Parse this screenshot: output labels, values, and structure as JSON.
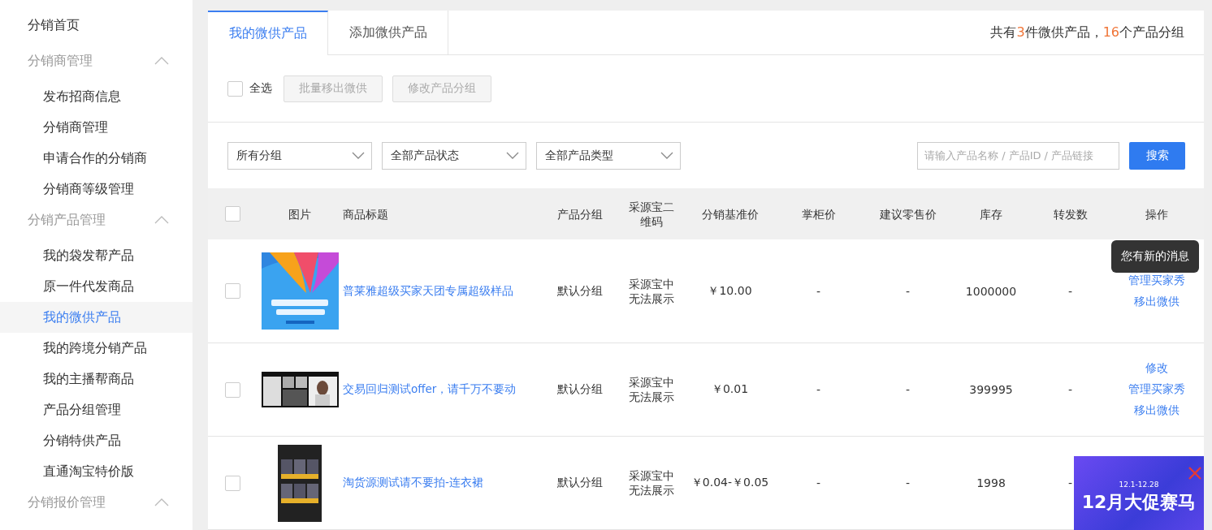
{
  "sidebar": {
    "items": [
      {
        "label": "分销首页",
        "kind": "link",
        "selected": false
      },
      {
        "label": "分销商管理",
        "kind": "group",
        "expanded": true,
        "children": [
          {
            "label": "发布招商信息",
            "selected": false
          },
          {
            "label": "分销商管理",
            "selected": false
          },
          {
            "label": "申请合作的分销商",
            "selected": false
          },
          {
            "label": "分销商等级管理",
            "selected": false
          }
        ]
      },
      {
        "label": "分销产品管理",
        "kind": "group",
        "expanded": true,
        "children": [
          {
            "label": "我的袋发帮产品",
            "selected": false
          },
          {
            "label": "原一件代发商品",
            "selected": false
          },
          {
            "label": "我的微供产品",
            "selected": true
          },
          {
            "label": "我的跨境分销产品",
            "selected": false
          },
          {
            "label": "我的主播帮商品",
            "selected": false
          },
          {
            "label": "产品分组管理",
            "selected": false
          },
          {
            "label": "分销特供产品",
            "selected": false
          },
          {
            "label": "直通淘宝特价版",
            "selected": false
          }
        ]
      },
      {
        "label": "分销报价管理",
        "kind": "group",
        "expanded": true
      }
    ]
  },
  "tabs": [
    {
      "label": "我的微供产品",
      "selected": true
    },
    {
      "label": "添加微供产品",
      "selected": false
    }
  ],
  "summary": [
    {
      "text": "共有",
      "highlight": false
    },
    {
      "text": "3",
      "highlight": true
    },
    {
      "text": "件微供产品，",
      "highlight": false
    },
    {
      "text": "16",
      "highlight": true
    },
    {
      "text": "个产品分组",
      "highlight": false
    }
  ],
  "toolbar": {
    "select_all": {
      "label": "全选",
      "checked": false
    },
    "buttons": [
      {
        "label": "批量移出微供",
        "disabled": true
      },
      {
        "label": "修改产品分组",
        "disabled": true
      }
    ]
  },
  "filters": {
    "selects": [
      "所有分组",
      "全部产品状态",
      "全部产品类型"
    ],
    "search": {
      "placeholder": "请输入产品名称 / 产品ID / 产品链接"
    },
    "search_button": "搜索"
  },
  "table": {
    "header_checked": false,
    "columns": [
      "图片",
      "商品标题",
      "产品分组",
      "采源宝二维码",
      "分销基准价",
      "掌柜价",
      "建议零售价",
      "库存",
      "转发数",
      "操作"
    ],
    "rows": [
      {
        "checked": false,
        "image": {
          "kind": "picture"
        },
        "title": "普莱雅超级买家天团专属超级样品",
        "group": "默认分组",
        "qr": "采源宝中无法展示",
        "base_price": "￥10.00",
        "shop_price": "-",
        "retail_price": "-",
        "stock": "1000000",
        "forwards": "-",
        "actions": [
          "管理买家秀",
          "移出微供"
        ]
      },
      {
        "checked": false,
        "image": {
          "kind": "picture"
        },
        "title": "交易回归测试offer，请千万不要动",
        "group": "默认分组",
        "qr": "采源宝中无法展示",
        "base_price": "￥0.01",
        "shop_price": "-",
        "retail_price": "-",
        "stock": "399995",
        "forwards": "-",
        "actions": [
          "修改",
          "管理买家秀",
          "移出微供"
        ]
      },
      {
        "checked": false,
        "image": {
          "kind": "picture"
        },
        "title": "淘货源测试请不要拍-连衣裙",
        "group": "默认分组",
        "qr": "采源宝中无法展示",
        "base_price": "￥0.04-￥0.05",
        "shop_price": "-",
        "retail_price": "-",
        "stock": "1998",
        "forwards": "-"
      }
    ]
  },
  "tooltip": "您有新的消息",
  "promo": {
    "dates": "12.1-12.28",
    "title": "12月大促赛马"
  }
}
